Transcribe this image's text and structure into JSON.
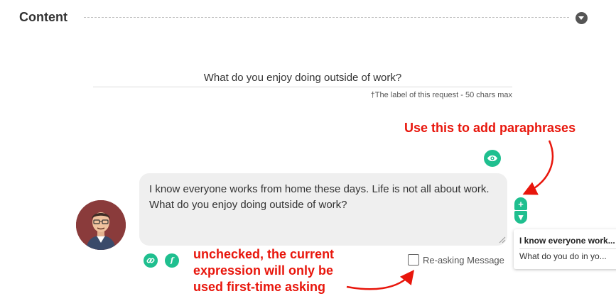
{
  "section": {
    "title": "Content"
  },
  "request_label": {
    "value": "What do you enjoy doing outside of work?",
    "hint": "†The label of this request - 50 chars max"
  },
  "message": {
    "text": "I know everyone works from home these days. Life is not all about work. What do you enjoy doing outside of work?"
  },
  "stepper": {
    "up": "+",
    "down": "▾"
  },
  "paraphrases": {
    "title": "I know everyone work...",
    "item": "What do you do in yo..."
  },
  "reasking": {
    "label": "Re-asking Message",
    "checked": false
  },
  "tools": {
    "function_label": "f"
  },
  "annotations": {
    "top": "Use this to add paraphrases",
    "bottom_line1": "unchecked, the current",
    "bottom_line2": "expression will only be",
    "bottom_line3": "used first-time asking"
  },
  "colors": {
    "accent": "#1fbf8f",
    "annotation": "#e8160c",
    "bubble": "#efefef"
  },
  "icons": [
    "chevron-down-icon",
    "eye-icon",
    "link-icon",
    "function-icon",
    "avatar"
  ]
}
